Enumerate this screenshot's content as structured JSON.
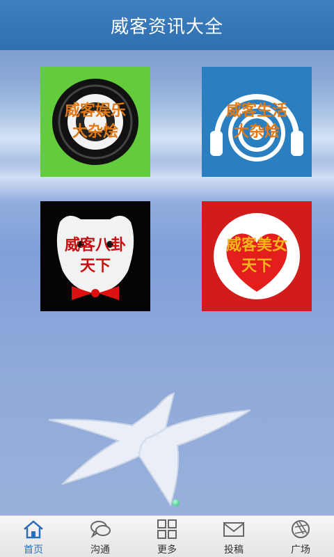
{
  "header": {
    "title": "威客资讯大全"
  },
  "tiles": [
    {
      "line1": "威客娱乐",
      "line2": "大杂烩"
    },
    {
      "line1": "威客生活",
      "line2": "大杂烩"
    },
    {
      "line1": "威客八卦",
      "line2": "天下"
    },
    {
      "line1": "威客美女",
      "line2": "天下"
    }
  ],
  "tabs": [
    {
      "label": "首页",
      "icon": "home-icon",
      "active": true
    },
    {
      "label": "沟通",
      "icon": "chat-icon"
    },
    {
      "label": "更多",
      "icon": "grid-icon"
    },
    {
      "label": "投稿",
      "icon": "mail-icon"
    },
    {
      "label": "广场",
      "icon": "aperture-icon"
    }
  ],
  "colors": {
    "titlebar": "#2f6fb0",
    "active_tab": "#2a6fb8"
  }
}
